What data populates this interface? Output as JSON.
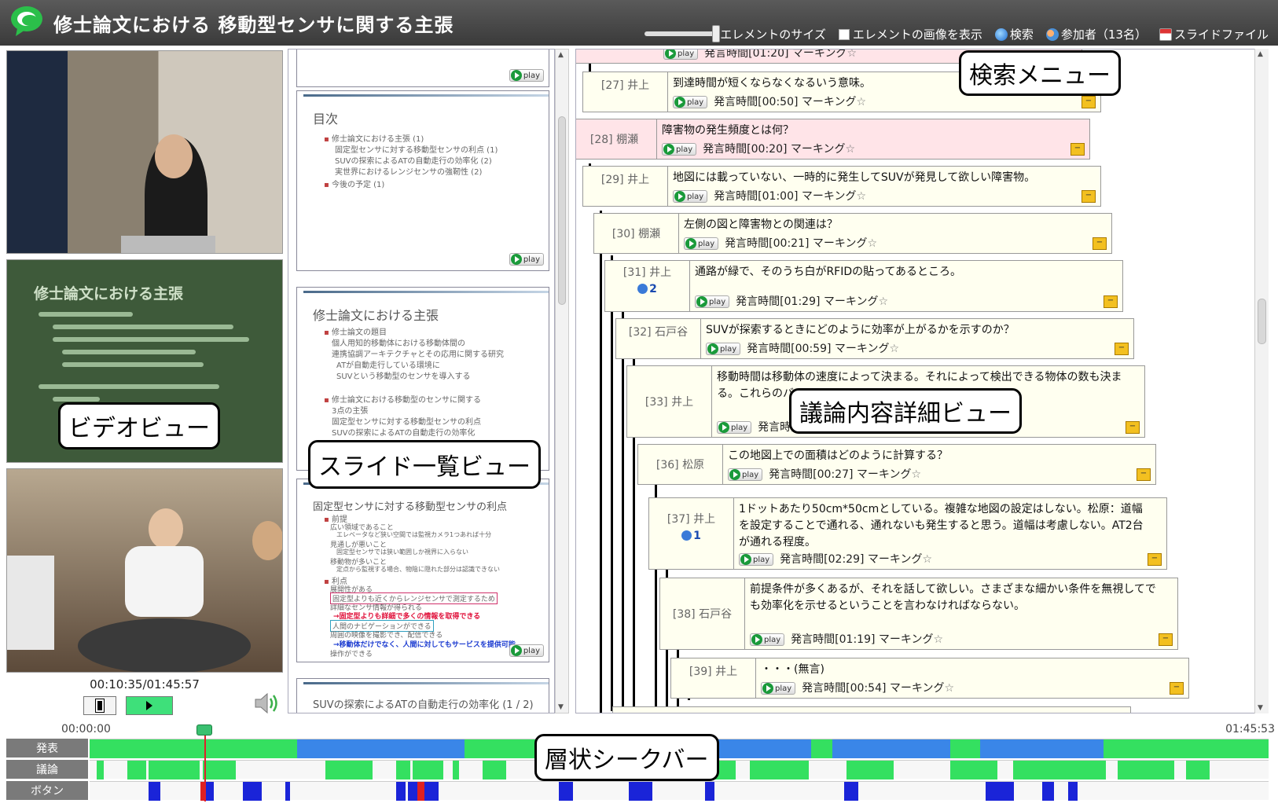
{
  "app": {
    "title": "修士論文における 移動型センサに関する主張",
    "brand_color": "#2bbf4a"
  },
  "toolbar": {
    "element_size": "エレメントのサイズ",
    "show_images": "エレメントの画像を表示",
    "search": "検索",
    "participants": "参加者（13名）",
    "slide_file": "スライドファイル"
  },
  "video": {
    "slide_title": "修士論文における主張",
    "timecode": "00:10:35/01:45:57"
  },
  "slides": {
    "play_label": "play",
    "items": [
      {
        "title": "",
        "lines": []
      },
      {
        "title": "目次",
        "lines": [
          "修士論文における主張 (1)",
          "固定型センサに対する移動型センサの利点 (1)",
          "SUVの探索によるATの自動走行の効率化 (2)",
          "実世界におけるレンジセンサの強靭性 (2)",
          "今後の予定 (1)"
        ]
      },
      {
        "title": "修士論文における主張",
        "lines": [
          "修士論文の題目",
          "個人用知的移動体における移動体間の",
          "連携協調アーキテクチャとその応用に関する研究",
          "ATが自動走行している環境に",
          "SUVという移動型のセンサを導入する",
          "修士論文における移動型のセンサに関する",
          "3点の主張",
          "固定型センサに対する移動型センサの利点",
          "SUVの探索によるATの自動走行の効率化"
        ]
      },
      {
        "title": "固定型センサに対する移動型センサの利点",
        "lines": [
          "前提",
          "広い領域であること",
          "エレベータなど狭い空間では監視カメラ1つあれば十分",
          "見通しが悪いこと",
          "固定型センサでは狭い範囲しか視界に入らない",
          "移動物が多いこと",
          "定点から監視する場合、物陰に隠れた部分は認識できない",
          "利点",
          "展開性がある",
          "固定型よりも近くからレンジセンサで測定するため",
          "詳細なセンサ情報が得られる",
          "→固定型よりも詳細で多くの情報を取得できる",
          "人間のナビゲーションができる",
          "周囲の映像を撮影でき、配信できる",
          "→移動体だけでなく、人間に対してもサービスを提供可能",
          "操作ができる"
        ]
      },
      {
        "title": "SUVの探索によるATの自動走行の効率化 (1 / 2)",
        "lines": []
      }
    ]
  },
  "discussion": {
    "play_label": "play",
    "mark_label": "マーキング",
    "entries": [
      {
        "id": "",
        "speaker": "",
        "text": "",
        "time": "発言時間[01:20]",
        "replies": ""
      },
      {
        "id": "[27]",
        "speaker": "井上",
        "text": "到達時間が短くならなくなるいう意味。",
        "time": "発言時間[00:50]",
        "replies": ""
      },
      {
        "id": "[28]",
        "speaker": "棚瀬",
        "text": "障害物の発生頻度とは何？",
        "time": "発言時間[00:20]",
        "replies": ""
      },
      {
        "id": "[29]",
        "speaker": "井上",
        "text": "地図には載っていない、一時的に発生してSUVが発見して欲しい障害物。",
        "time": "発言時間[01:00]",
        "replies": ""
      },
      {
        "id": "[30]",
        "speaker": "棚瀬",
        "text": "左側の図と障害物との関連は？",
        "time": "発言時間[00:21]",
        "replies": ""
      },
      {
        "id": "[31]",
        "speaker": "井上",
        "text": "通路が緑で、そのうち白がRFIDの貼ってあるところ。",
        "time": "発言時間[01:29]",
        "replies": "2"
      },
      {
        "id": "[32]",
        "speaker": "石戸谷",
        "text": "SUVが探索するときにどのように効率が上がるかを示すのか？",
        "time": "発言時間[00:59]",
        "replies": ""
      },
      {
        "id": "[33]",
        "speaker": "井上",
        "text": "移動時間は移動体の速度によって決まる。それによって検出できる物体の数も決まる。これらのバ",
        "time": "発言時間[01:30]",
        "replies": ""
      },
      {
        "id": "[36]",
        "speaker": "松原",
        "text": "この地図上での面積はどのように計算する？",
        "time": "発言時間[00:27]",
        "replies": ""
      },
      {
        "id": "[37]",
        "speaker": "井上",
        "text": "1ドットあたり50cm*50cmとしている。複雑な地図の設定はしない。松原：道幅を設定することで通れる、通れないも発生すると思う。道幅は考慮しない。AT2台が通れる程度。",
        "time": "発言時間[02:29]",
        "replies": "1"
      },
      {
        "id": "[38]",
        "speaker": "石戸谷",
        "text": "前提条件が多くあるが、それを話して欲しい。さまざまな細かい条件を無視してでも効率化を示せるということを言わなければならない。",
        "time": "発言時間[01:19]",
        "replies": ""
      },
      {
        "id": "[39]",
        "speaker": "井上",
        "text": "・・・(無言)",
        "time": "発言時間[00:54]",
        "replies": ""
      }
    ]
  },
  "seekbar": {
    "start": "00:00:00",
    "end": "01:45:53",
    "rows": [
      "発表",
      "議論",
      "ボタン"
    ],
    "playhead": 0.097
  },
  "annotations": {
    "search_menu": "検索メニュー",
    "detail_view": "議論内容詳細ビュー",
    "video_view": "ビデオビュー",
    "slide_list_view": "スライド一覧ビュー",
    "seekbar": "層状シークバー"
  }
}
